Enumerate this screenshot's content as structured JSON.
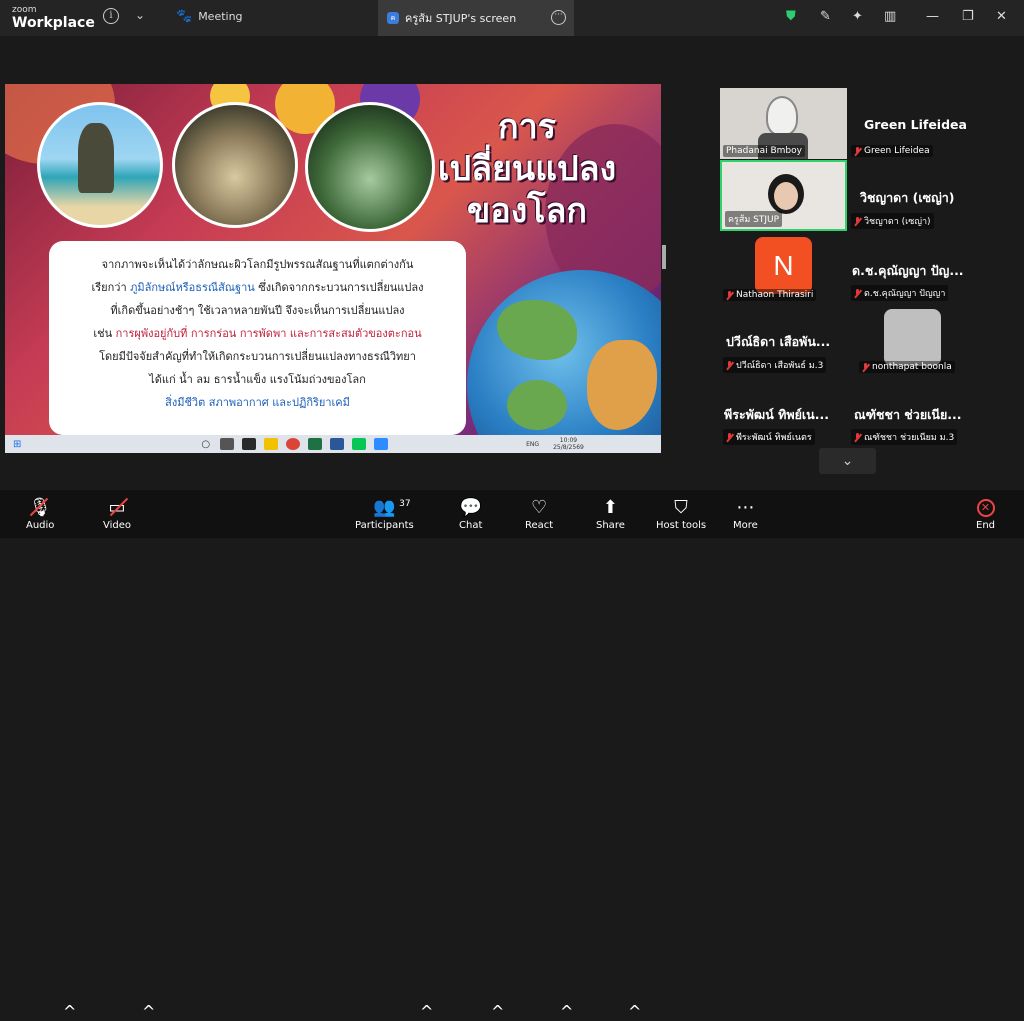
{
  "app": {
    "brand_line1": "zoom",
    "brand_line2": "Workplace"
  },
  "topbar": {
    "meeting_label": "Meeting",
    "share_tab_label": "ครูส้ม STJUP's screen"
  },
  "slide": {
    "title_lines": [
      "การ",
      "เปลี่ยนแปลง",
      "ของโลก"
    ],
    "text": {
      "line1": "จากภาพจะเห็นได้ว่าลักษณะผิวโลกมีรูปพรรณสัณฐานที่แตกต่างกัน",
      "line2_prefix": "เรียกว่า ",
      "line2_highlight": "ภูมิลักษณ์หรือธรณีสัณฐาน",
      "line2_suffix": " ซึ่งเกิดจากกระบวนการเปลี่ยนแปลง",
      "line3": "ที่เกิดขึ้นอย่างช้าๆ ใช้เวลาหลายพันปี จึงจะเห็นการเปลี่ยนแปลง",
      "line4_prefix": "เช่น ",
      "line4_highlight": "การผุพังอยู่กับที่ การกร่อน การพัดพา และการสะสมตัวของตะกอน",
      "line5": "โดยมีปัจจัยสำคัญที่ทำให้เกิดกระบวนการเปลี่ยนแปลงทางธรณีวิทยา",
      "line6": "ได้แก่ น้ำ ลม ธารน้ำแข็ง แรงโน้มถ่วงของโลก",
      "line7": "สิ่งมีชีวิต สภาพอากาศ และปฏิกิริยาเคมี"
    }
  },
  "taskbar": {
    "lang": "ENG",
    "time": "10:09",
    "date": "25/8/2569"
  },
  "participants": [
    {
      "tile_name": "Phadanai Bmboy",
      "side_name": "Green Lifeidea",
      "side_label": "Green Lifeidea"
    },
    {
      "tile_name": "ครูส้ม STJUP",
      "side_name": "วิชญาดา (เซญ่า)",
      "side_label": "วิชญาดา (เซญ่า)"
    },
    {
      "tile_name": "Nathaon Thirasiri",
      "avatar_letter": "N",
      "side_name": "ด.ช.คุณัญญา ปัญ...",
      "side_label": "ด.ช.คุณัญญา ปัญญา"
    },
    {
      "tile_name": "ปวีณ์ธิดา เสือพัน...",
      "tile_label": "ปวีณ์ธิดา เสือพันธ์ ม.3",
      "side_label": "nonthapat boonla"
    },
    {
      "tile_name": "พีระพัฒน์ ทิพย์เน...",
      "tile_label": "พีระพัฒน์ ทิพย์เนตร",
      "side_name": "ณฑัชชา ช่วยเนีย...",
      "side_label": "ณฑัชชา ช่วยเนียม ม.3"
    }
  ],
  "toolbar": {
    "audio": "Audio",
    "video": "Video",
    "participants": "Participants",
    "participants_count": "37",
    "chat": "Chat",
    "react": "React",
    "share": "Share",
    "host_tools": "Host tools",
    "more": "More",
    "end": "End"
  }
}
